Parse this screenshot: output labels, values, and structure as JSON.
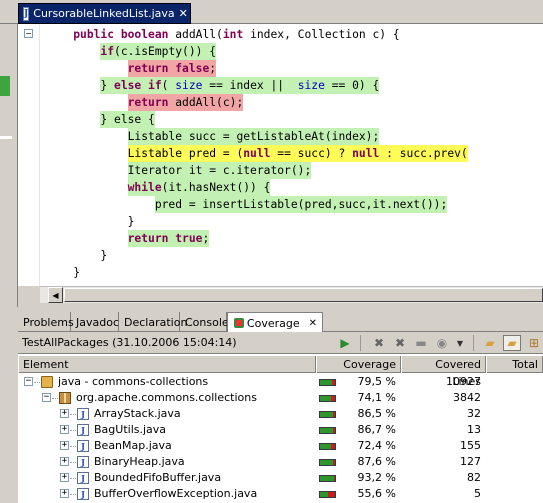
{
  "editor": {
    "tab_title": "CursorableLinkedList.java",
    "file_icon": "J",
    "close_glyph": "✕",
    "fold_glyph": "−"
  },
  "views": {
    "tabs": [
      {
        "label": "Problems"
      },
      {
        "label": "Javadoc"
      },
      {
        "label": "Declaration"
      },
      {
        "label": "Console"
      },
      {
        "label": "Coverage",
        "active": true
      }
    ],
    "coverage_close_glyph": "✕"
  },
  "coverage": {
    "session": "TestAllPackages (31.10.2006 15:04:14)",
    "columns": [
      "Element",
      "Coverage",
      "Covered Lines",
      "Total"
    ],
    "rows": [
      {
        "name": "java - commons-collections",
        "coverage": "79,5 %",
        "covered": "10927",
        "fraction": 0.795,
        "expand": "−"
      },
      {
        "name": "org.apache.commons.collections",
        "coverage": "74,1 %",
        "covered": "3842",
        "fraction": 0.741,
        "expand": "−"
      },
      {
        "name": "ArrayStack.java",
        "coverage": "86,5 %",
        "covered": "32",
        "fraction": 0.865,
        "expand": "+"
      },
      {
        "name": "BagUtils.java",
        "coverage": "86,7 %",
        "covered": "13",
        "fraction": 0.867,
        "expand": "+"
      },
      {
        "name": "BeanMap.java",
        "coverage": "72,4 %",
        "covered": "155",
        "fraction": 0.724,
        "expand": "+"
      },
      {
        "name": "BinaryHeap.java",
        "coverage": "87,6 %",
        "covered": "127",
        "fraction": 0.876,
        "expand": "+"
      },
      {
        "name": "BoundedFifoBuffer.java",
        "coverage": "93,2 %",
        "covered": "82",
        "fraction": 0.932,
        "expand": "+"
      },
      {
        "name": "BufferOverflowException.java",
        "coverage": "55,6 %",
        "covered": "5",
        "fraction": 0.556,
        "expand": "+"
      }
    ]
  },
  "colors": {
    "covered_line": "#c3f0b3",
    "missed_line": "#f2a5a5",
    "partial_line": "#fffc57",
    "coverage_bar_covered": "#2c962c",
    "coverage_bar_missed": "#c81e1e"
  },
  "icons": {
    "toolbar": [
      "relaunch-icon",
      "remove-session-icon",
      "remove-all-sessions-icon",
      "merge-sessions-icon",
      "select-session-icon",
      "dropdown-icon",
      "show-projects-icon",
      "show-packages-icon",
      "show-types-icon"
    ]
  }
}
